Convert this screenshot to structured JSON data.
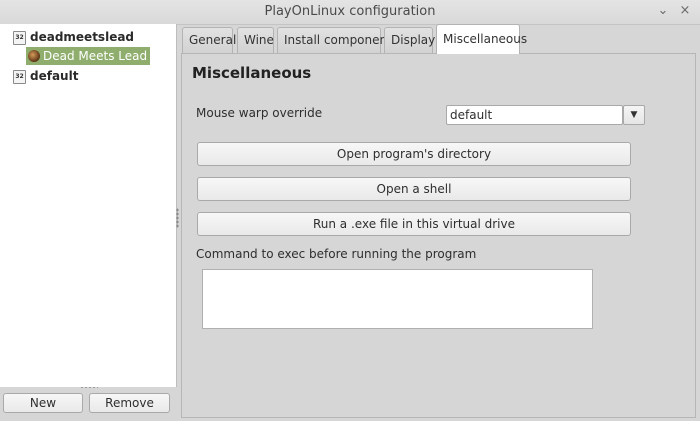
{
  "window": {
    "title": "PlayOnLinux configuration",
    "minimize_glyph": "⌄",
    "close_glyph": "×"
  },
  "tree": {
    "items": [
      {
        "label": "deadmeetslead",
        "icon": "32-bit-prefix-icon",
        "badge": "32"
      },
      {
        "label": "Dead Meets Lead",
        "icon": "game-icon",
        "selected": true
      },
      {
        "label": "default",
        "icon": "32-bit-prefix-icon",
        "badge": "32"
      }
    ],
    "new_label": "New",
    "remove_label": "Remove"
  },
  "tabs": [
    {
      "label": "General"
    },
    {
      "label": "Wine"
    },
    {
      "label": "Install components"
    },
    {
      "label": "Display"
    },
    {
      "label": "Miscellaneous",
      "active": true
    }
  ],
  "misc": {
    "heading": "Miscellaneous",
    "mouse_warp_label": "Mouse warp override",
    "mouse_warp_value": "default",
    "dropdown_arrow": "▼",
    "open_dir_label": "Open program's directory",
    "open_shell_label": "Open a shell",
    "run_exe_label": "Run a .exe file in this virtual drive",
    "command_label": "Command to exec before running the program",
    "command_value": ""
  },
  "colors": {
    "selection": "#8fae6d",
    "window_bg": "#d6d6d6"
  }
}
